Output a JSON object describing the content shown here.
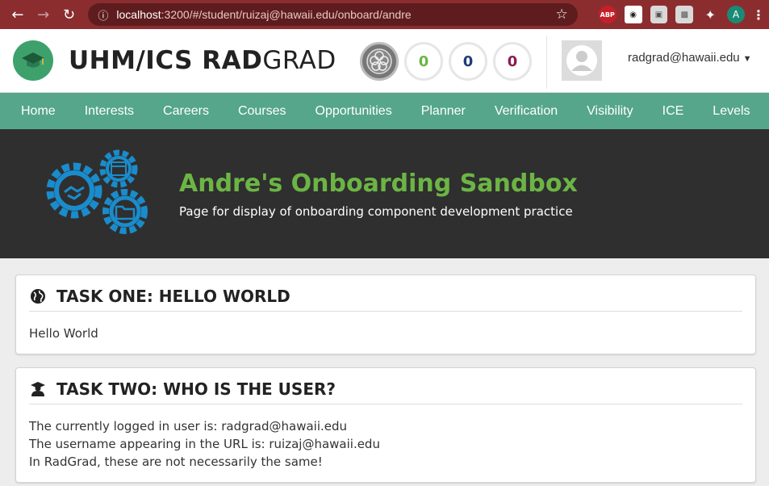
{
  "browser": {
    "url_host": "localhost",
    "url_path": ":3200/#/student/ruizaj@hawaii.edu/onboard/andre",
    "ext_abp": "ABP",
    "ext_avatar": "A"
  },
  "header": {
    "brand_bold": "UHM/ICS RAD",
    "brand_light": "GRAD",
    "ice": [
      {
        "value": "0",
        "color": "#6cb545"
      },
      {
        "value": "0",
        "color": "#1f3c7a"
      },
      {
        "value": "0",
        "color": "#8a1e54"
      }
    ],
    "user_email": "radgrad@hawaii.edu"
  },
  "nav": {
    "items": [
      "Home",
      "Interests",
      "Careers",
      "Courses",
      "Opportunities",
      "Planner",
      "Verification",
      "Visibility",
      "ICE",
      "Levels"
    ]
  },
  "banner": {
    "title": "Andre's Onboarding Sandbox",
    "subtitle": "Page for display of onboarding component development practice"
  },
  "task_one": {
    "title": "TASK ONE: HELLO WORLD",
    "body": "Hello World"
  },
  "task_two": {
    "title": "TASK TWO: WHO IS THE USER?",
    "line1": "The currently logged in user is: radgrad@hawaii.edu",
    "line2": "The username appearing in the URL is: ruizaj@hawaii.edu",
    "line3": "In RadGrad, these are not necessarily the same!"
  },
  "colors": {
    "nav_bg": "#55a68b",
    "banner_title": "#6cb545",
    "gear_blue": "#1a8ccc"
  }
}
